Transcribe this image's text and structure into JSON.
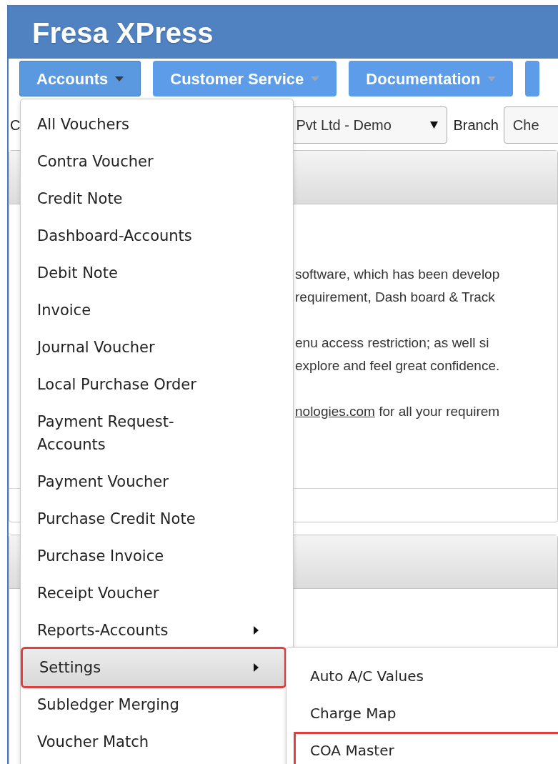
{
  "app_title": "Fresa XPress",
  "nav": [
    {
      "label": "Accounts",
      "selected": true
    },
    {
      "label": "Customer Service",
      "selected": false
    },
    {
      "label": "Documentation",
      "selected": false
    }
  ],
  "filter": {
    "label_1": "C",
    "company_value": "Pvt Ltd - Demo",
    "branch_label": "Branch",
    "branch_value": "Che"
  },
  "content": {
    "paragraphs": [
      {
        "lines": [
          {
            "text": "software, which has been develop"
          },
          {
            "text": "requirement, Dash board & Track"
          }
        ]
      },
      {
        "lines": [
          {
            "text": "enu access restriction; as well si"
          },
          {
            "text": "explore and feel great confidence."
          }
        ]
      },
      {
        "lines": [
          {
            "link": "nologies.com",
            "text": " for all your requirem"
          }
        ]
      }
    ]
  },
  "menu": {
    "items": [
      {
        "label": "All Vouchers",
        "has_submenu": false,
        "selected": false,
        "outlined": false
      },
      {
        "label": "Contra Voucher",
        "has_submenu": false,
        "selected": false,
        "outlined": false
      },
      {
        "label": "Credit Note",
        "has_submenu": false,
        "selected": false,
        "outlined": false
      },
      {
        "label": "Dashboard-Accounts",
        "has_submenu": false,
        "selected": false,
        "outlined": false
      },
      {
        "label": "Debit Note",
        "has_submenu": false,
        "selected": false,
        "outlined": false
      },
      {
        "label": "Invoice",
        "has_submenu": false,
        "selected": false,
        "outlined": false
      },
      {
        "label": "Journal Voucher",
        "has_submenu": false,
        "selected": false,
        "outlined": false
      },
      {
        "label": "Local Purchase Order",
        "has_submenu": false,
        "selected": false,
        "outlined": false
      },
      {
        "label": "Payment Request-Accounts",
        "has_submenu": false,
        "selected": false,
        "outlined": false
      },
      {
        "label": "Payment Voucher",
        "has_submenu": false,
        "selected": false,
        "outlined": false
      },
      {
        "label": "Purchase Credit Note",
        "has_submenu": false,
        "selected": false,
        "outlined": false
      },
      {
        "label": "Purchase Invoice",
        "has_submenu": false,
        "selected": false,
        "outlined": false
      },
      {
        "label": "Receipt Voucher",
        "has_submenu": false,
        "selected": false,
        "outlined": false
      },
      {
        "label": "Reports-Accounts",
        "has_submenu": true,
        "selected": false,
        "outlined": false
      },
      {
        "label": "Settings",
        "has_submenu": true,
        "selected": true,
        "outlined": true
      },
      {
        "label": "Subledger Merging",
        "has_submenu": false,
        "selected": false,
        "outlined": false
      },
      {
        "label": "Voucher Match",
        "has_submenu": false,
        "selected": false,
        "outlined": false
      }
    ]
  },
  "submenu": {
    "items": [
      {
        "label": "Auto A/C Values",
        "selected": false,
        "outlined": false
      },
      {
        "label": "Charge Map",
        "selected": false,
        "outlined": false
      },
      {
        "label": "COA Master",
        "selected": false,
        "outlined": true
      }
    ]
  }
}
